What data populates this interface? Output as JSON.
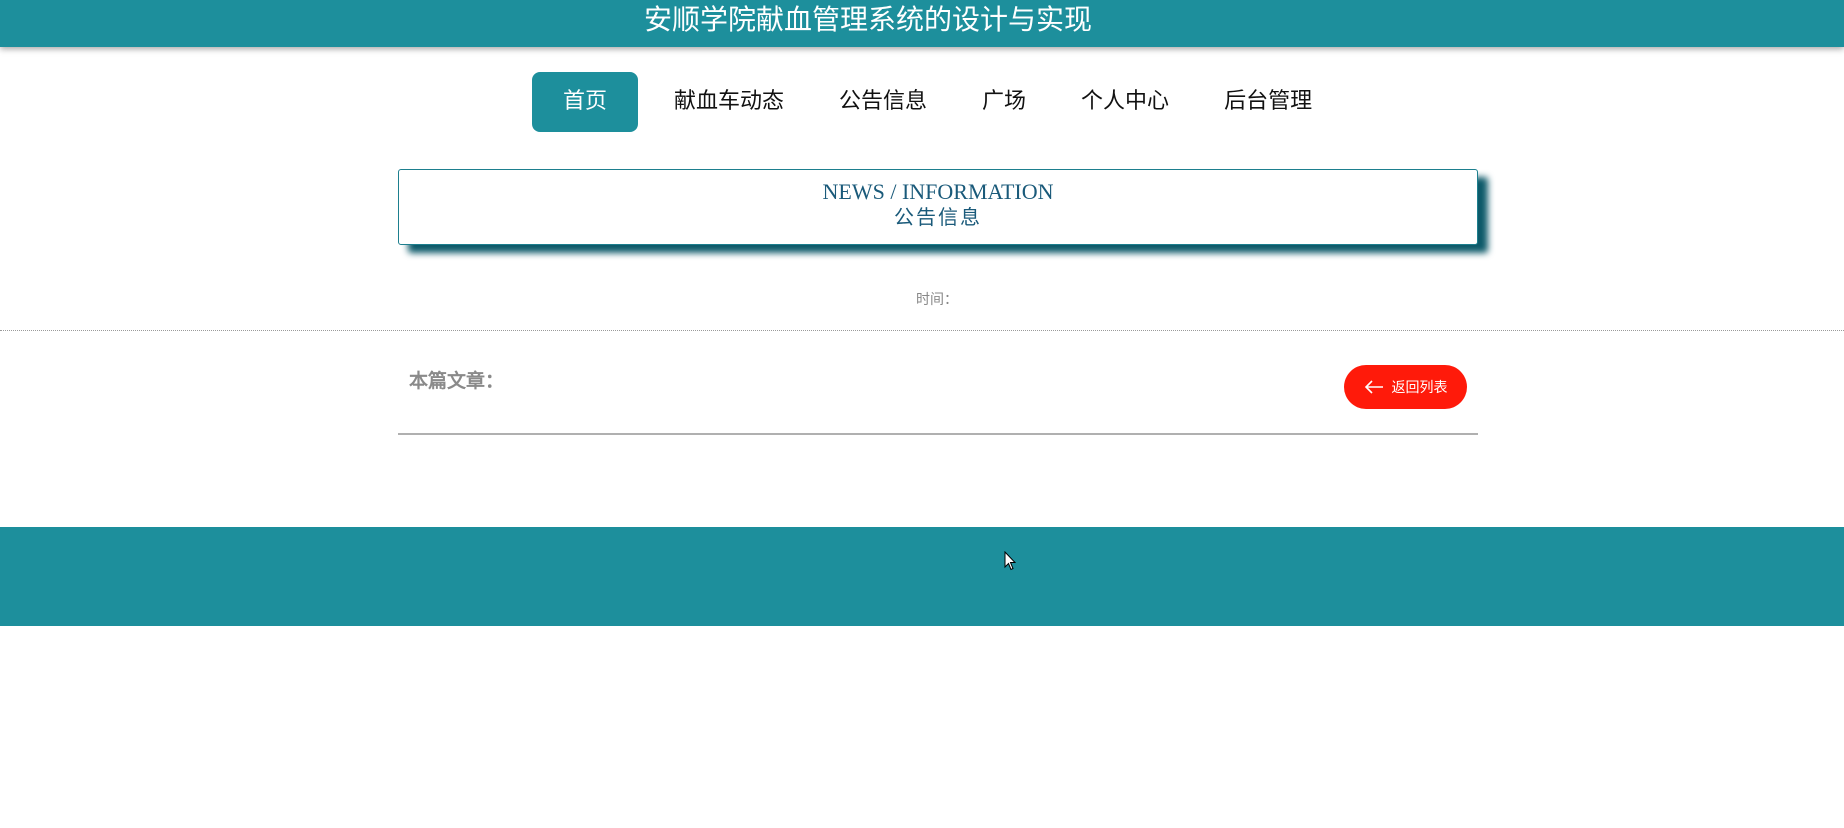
{
  "header": {
    "title": "安顺学院献血管理系统的设计与实现"
  },
  "nav": {
    "items": [
      {
        "label": "首页",
        "active": true
      },
      {
        "label": "献血车动态",
        "active": false
      },
      {
        "label": "公告信息",
        "active": false
      },
      {
        "label": "广场",
        "active": false
      },
      {
        "label": "个人中心",
        "active": false
      },
      {
        "label": "后台管理",
        "active": false
      }
    ]
  },
  "section": {
    "title_en": "NEWS / INFORMATION",
    "title_cn": "公告信息"
  },
  "article": {
    "time_label": "时间：",
    "article_label": "本篇文章：",
    "back_button_label": "返回列表"
  },
  "colors": {
    "primary": "#1d8f9c",
    "back_button": "#ff1a0a",
    "heading_text": "#1a5a7a"
  },
  "icons": {
    "back": "arrow-left-icon",
    "cursor": "mouse-pointer-icon"
  }
}
